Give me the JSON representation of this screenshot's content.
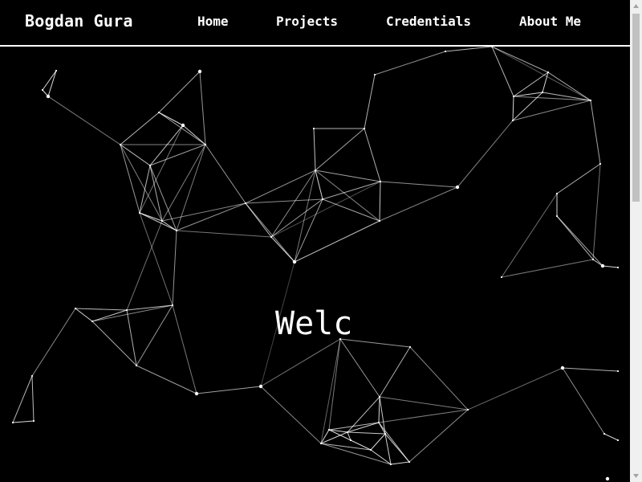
{
  "brand": {
    "name": "Bogdan Gura"
  },
  "nav": {
    "items": [
      {
        "label": "Home"
      },
      {
        "label": "Projects"
      },
      {
        "label": "Credentials"
      },
      {
        "label": "About Me"
      }
    ]
  },
  "hero": {
    "headline": "Welc"
  },
  "colors": {
    "background": "#000000",
    "text": "#ffffff",
    "nav_border": "#ffffff",
    "scrollbar_track": "#f0f0f0",
    "scrollbar_thumb": "#c1c1c1"
  },
  "icons": {
    "scroll_up": "triangle-up-icon",
    "scroll_down": "triangle-down-icon"
  }
}
